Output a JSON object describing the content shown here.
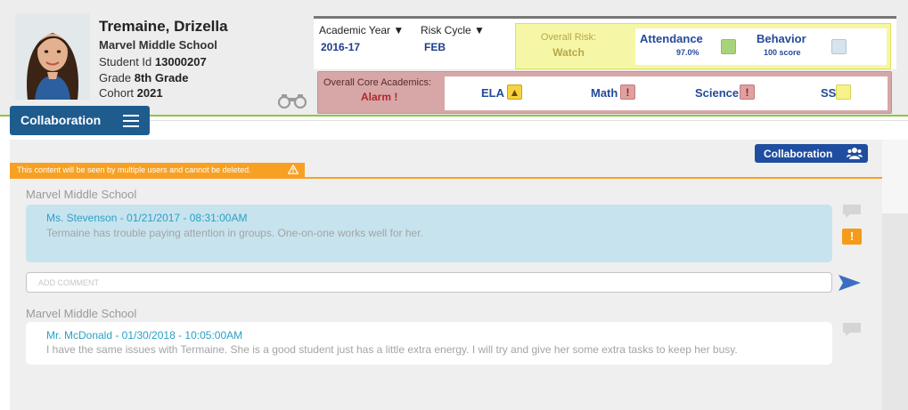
{
  "student": {
    "name": "Tremaine, Drizella",
    "school": "Marvel Middle School",
    "id_label": "Student Id ",
    "id_value": "13000207",
    "grade_label": "Grade ",
    "grade_value": "8th Grade",
    "cohort_label": "Cohort ",
    "cohort_value": "2021"
  },
  "filters": {
    "academic_year_label": "Academic Year ▼",
    "academic_year_value": "2016-17",
    "risk_cycle_label": "Risk Cycle ▼",
    "risk_cycle_value": "FEB"
  },
  "risk": {
    "overall_label": "Overall Risk:",
    "overall_value": "Watch",
    "attendance_label": "Attendance",
    "attendance_value": "97.0%",
    "attendance_color": "#a9d37b",
    "behavior_label": "Behavior",
    "behavior_value": "100 score",
    "behavior_color": "#d6e4ee"
  },
  "core": {
    "label": "Overall Core Academics:",
    "value": "Alarm !",
    "subjects": [
      {
        "name": "ELA",
        "flag": "▲",
        "flag_color": "#f6d23c"
      },
      {
        "name": "Math",
        "flag": "!",
        "flag_color": "#e0a0a0"
      },
      {
        "name": "Science",
        "flag": "!",
        "flag_color": "#e0a0a0"
      },
      {
        "name": "SS",
        "flag": "",
        "flag_color": "#f7f38a"
      }
    ]
  },
  "tab": {
    "label": "Collaboration"
  },
  "collab_button": {
    "label": "Collaboration"
  },
  "warning": {
    "text": "This content will be seen by multiple users and cannot be deleted."
  },
  "comments": [
    {
      "school": "Marvel Middle School",
      "author": "Ms. Stevenson - 01/21/2017 - 08:31:00AM",
      "text": "Termaine has trouble paying attention in groups. One-on-one works well for her."
    },
    {
      "school": "Marvel Middle School",
      "author": "Mr. McDonald - 01/30/2018 - 10:05:00AM",
      "text": "I have the same issues with Termaine. She is a good student just has a little extra energy. I will try and give her some extra tasks to keep her busy."
    }
  ],
  "add_comment": {
    "placeholder": "ADD COMMENT",
    "value": ""
  }
}
